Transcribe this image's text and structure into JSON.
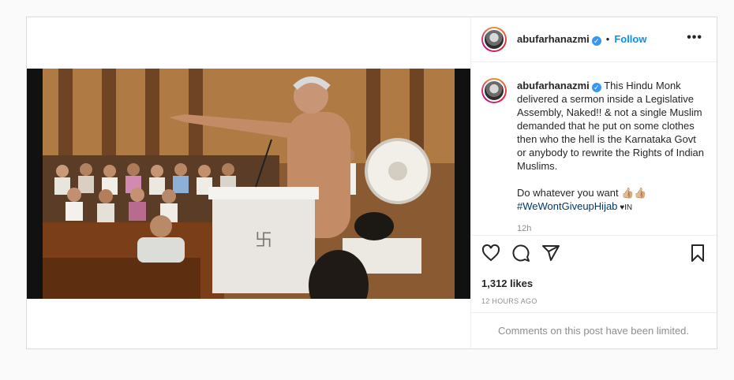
{
  "post": {
    "username": "abufarhanazmi",
    "verified_mark": "✓",
    "separator": "•",
    "follow_label": "Follow",
    "more_label": "•••",
    "caption": {
      "username": "abufarhanazmi",
      "text": "This Hindu Monk delivered a sermon inside a Legislative Assembly, Naked!! & not a single Muslim demanded that he put on some clothes then who the hell is the Karnataka Govt or anybody to rewrite the Rights of Indian Muslims.",
      "line2": "Do whatever you want 👍🏼👍🏼",
      "hashtag": "#WeWontGiveupHijab",
      "suffix": " ♥IN",
      "time": "12h"
    },
    "likes": "1,312 likes",
    "posted": "12 HOURS AGO",
    "comments_notice": "Comments on this post have been limited."
  },
  "icons": {
    "like": "heart-icon",
    "comment": "comment-icon",
    "share": "share-icon",
    "save": "bookmark-icon",
    "verified": "verified-badge-icon",
    "more": "more-options-icon"
  },
  "colors": {
    "accent": "#0095f6",
    "verified": "#3897f0",
    "hashtag": "#00376b",
    "muted": "#8e8e8e",
    "border": "#dbdbdb"
  }
}
